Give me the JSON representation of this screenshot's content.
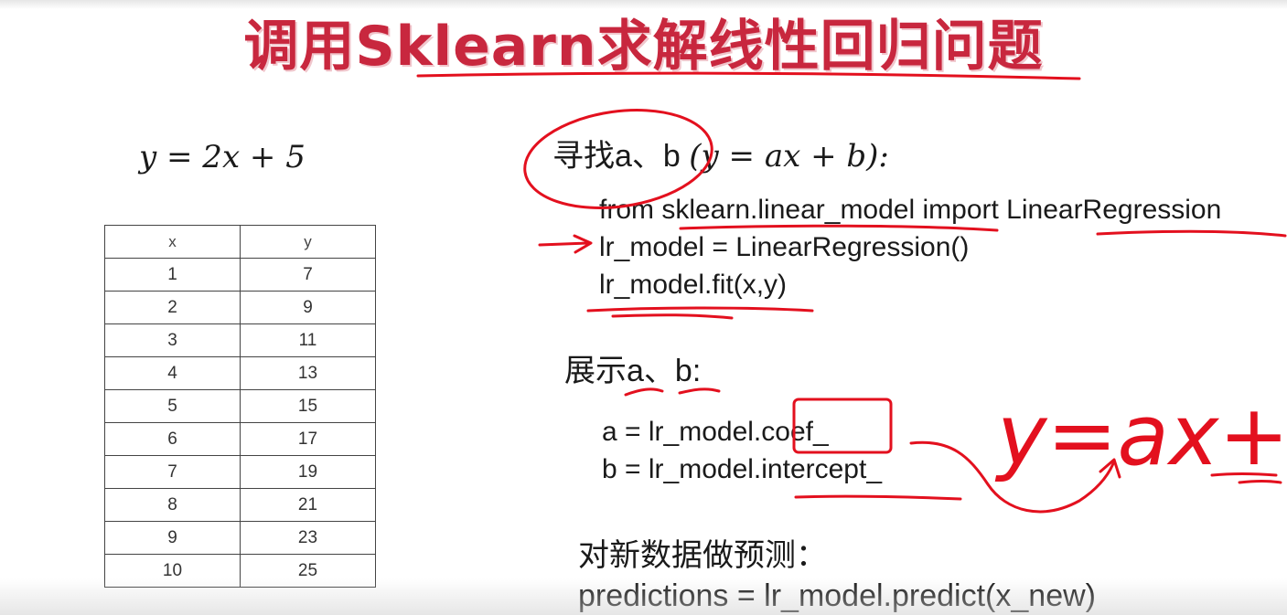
{
  "title": "调用Sklearn求解线性回归问题",
  "formula": "y = 2x + 5",
  "table": {
    "headers": [
      "x",
      "y"
    ],
    "rows": [
      [
        "1",
        "7"
      ],
      [
        "2",
        "9"
      ],
      [
        "3",
        "11"
      ],
      [
        "4",
        "13"
      ],
      [
        "5",
        "15"
      ],
      [
        "6",
        "17"
      ],
      [
        "7",
        "19"
      ],
      [
        "8",
        "21"
      ],
      [
        "9",
        "23"
      ],
      [
        "10",
        "25"
      ]
    ]
  },
  "section_find": {
    "heading_text": "寻找a、b",
    "heading_math": "(y = ax + b):",
    "code": [
      "from sklearn.linear_model import LinearRegression",
      "lr_model = LinearRegression()",
      "lr_model.fit(x,y)"
    ]
  },
  "section_show": {
    "heading": "展示a、b:",
    "code": [
      "a = lr_model.coef_",
      "b = lr_model.intercept_"
    ]
  },
  "section_predict": {
    "heading": "对新数据做预测：",
    "code": "predictions = lr_model.predict(x_new)"
  },
  "annotation": {
    "handwritten": "y=ax+b",
    "ink_color": "#e3101e"
  },
  "colors": {
    "title": "#c8273e",
    "text": "#1a1a1a"
  }
}
